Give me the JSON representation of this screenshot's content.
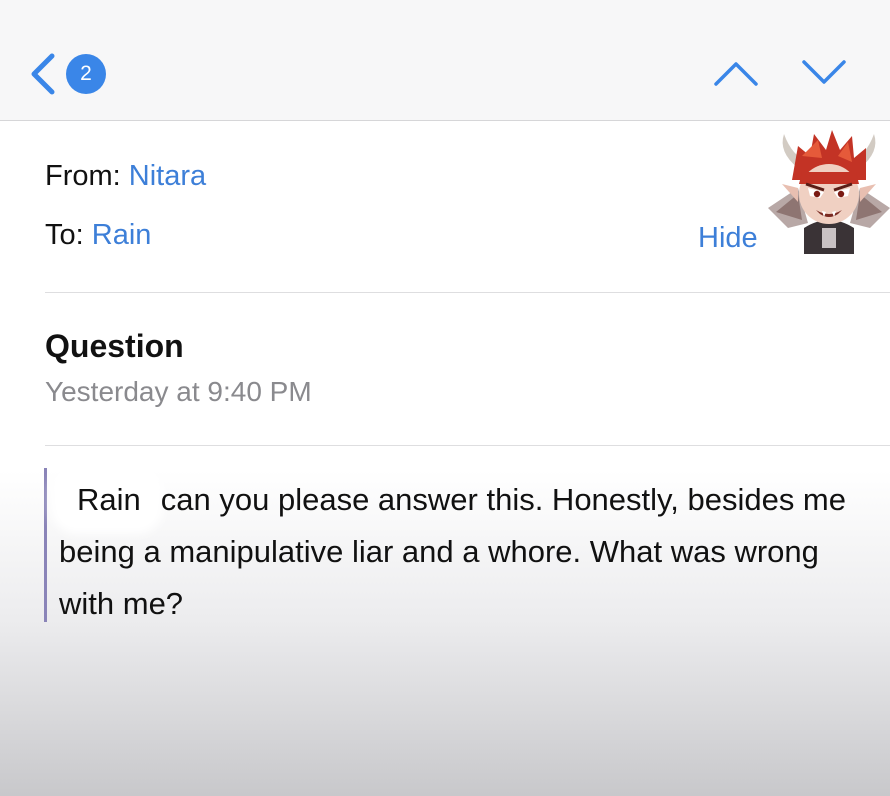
{
  "topbar": {
    "unread_count": "2",
    "icons": [
      "chevron-left-icon",
      "chevron-up-icon",
      "chevron-down-icon"
    ],
    "accent_color": "#3a86e8"
  },
  "header": {
    "from_label": "From:",
    "from_name": "Nitara",
    "to_label": "To:",
    "to_name": "Rain",
    "hide_label": "Hide"
  },
  "message": {
    "subject": "Question",
    "date": "Yesterday at 9:40 PM",
    "body_name": "Rain",
    "body_text": "can you please answer this. Honestly, besides me being a manipulative liar and a whore. What was wrong with me?"
  }
}
